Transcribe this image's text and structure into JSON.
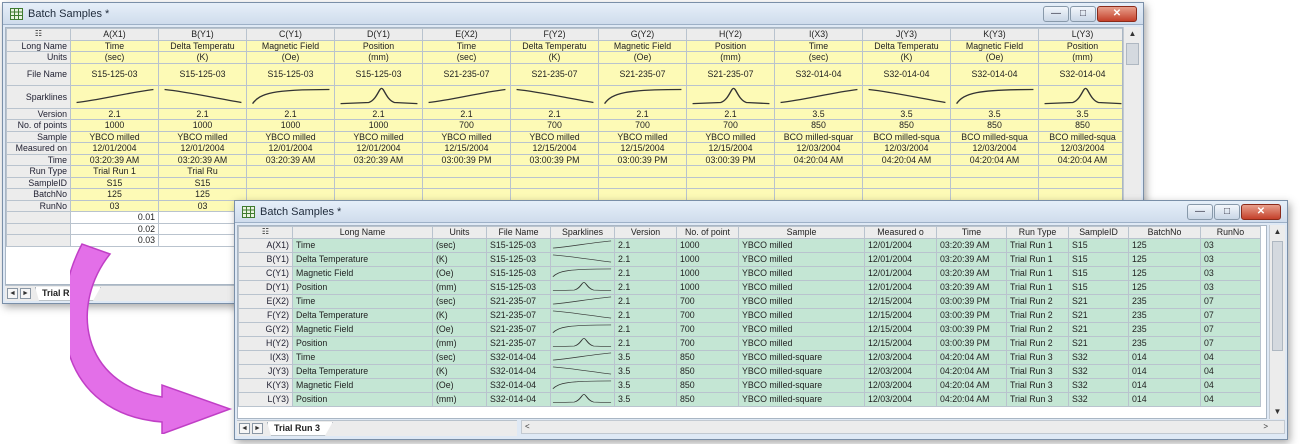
{
  "arrow_color": "#e36fe8",
  "window1": {
    "title": "Batch Samples *",
    "controls": {
      "minimize": "—",
      "maximize": "□",
      "close": "✕"
    },
    "corner_icon": "grid-corner-icon",
    "columns": [
      "A(X1)",
      "B(Y1)",
      "C(Y1)",
      "D(Y1)",
      "E(X2)",
      "F(Y2)",
      "G(Y2)",
      "H(Y2)",
      "I(X3)",
      "J(Y3)",
      "K(Y3)",
      "L(Y3)"
    ],
    "row_headers": {
      "long_name": "Long Name",
      "units": "Units",
      "file_name": "File Name",
      "sparklines": "Sparklines",
      "version": "Version",
      "points": "No. of points",
      "sample": "Sample",
      "measured": "Measured on",
      "time": "Time",
      "run_type": "Run Type",
      "sample_id": "SampleID",
      "batch_no": "BatchNo",
      "run_no": "RunNo"
    },
    "long_name": [
      "Time",
      "Delta Temperatu",
      "Magnetic Field",
      "Position",
      "Time",
      "Delta Temperatu",
      "Magnetic Field",
      "Position",
      "Time",
      "Delta Temperatu",
      "Magnetic Field",
      "Position"
    ],
    "units": [
      "(sec)",
      "(K)",
      "(Oe)",
      "(mm)",
      "(sec)",
      "(K)",
      "(Oe)",
      "(mm)",
      "(sec)",
      "(K)",
      "(Oe)",
      "(mm)"
    ],
    "file_name": [
      "S15-125-03",
      "S15-125-03",
      "S15-125-03",
      "S15-125-03",
      "S21-235-07",
      "S21-235-07",
      "S21-235-07",
      "S21-235-07",
      "S32-014-04",
      "S32-014-04",
      "S32-014-04",
      "S32-014-04"
    ],
    "sparkline_types": [
      "rise",
      "fall",
      "saturate",
      "peak",
      "rise",
      "fall",
      "saturate",
      "peak",
      "rise",
      "fall",
      "saturate",
      "peak"
    ],
    "version": [
      "2.1",
      "2.1",
      "2.1",
      "2.1",
      "2.1",
      "2.1",
      "2.1",
      "2.1",
      "3.5",
      "3.5",
      "3.5",
      "3.5"
    ],
    "points": [
      "1000",
      "1000",
      "1000",
      "1000",
      "700",
      "700",
      "700",
      "700",
      "850",
      "850",
      "850",
      "850"
    ],
    "sample": [
      "YBCO milled",
      "YBCO milled",
      "YBCO milled",
      "YBCO milled",
      "YBCO milled",
      "YBCO milled",
      "YBCO milled",
      "YBCO milled",
      "BCO milled-squar",
      "BCO milled-squa",
      "BCO milled-squa",
      "BCO milled-squa"
    ],
    "measured": [
      "12/01/2004",
      "12/01/2004",
      "12/01/2004",
      "12/01/2004",
      "12/15/2004",
      "12/15/2004",
      "12/15/2004",
      "12/15/2004",
      "12/03/2004",
      "12/03/2004",
      "12/03/2004",
      "12/03/2004"
    ],
    "time": [
      "03:20:39 AM",
      "03:20:39 AM",
      "03:20:39 AM",
      "03:20:39 AM",
      "03:00:39 PM",
      "03:00:39 PM",
      "03:00:39 PM",
      "03:00:39 PM",
      "04:20:04 AM",
      "04:20:04 AM",
      "04:20:04 AM",
      "04:20:04 AM"
    ],
    "run_type": [
      "Trial Run 1",
      "Trial Ru"
    ],
    "sample_id": [
      "S15",
      "S15"
    ],
    "batch_no": [
      "125",
      "125"
    ],
    "run_no": [
      "03",
      "03"
    ],
    "data_values": [
      "0.01",
      "0.02",
      "0.03"
    ],
    "sheet_tab": "Trial Run 1",
    "nav": {
      "prev": "◄",
      "next": "►"
    },
    "scroll_up": "▲"
  },
  "window2": {
    "title": "Batch Samples *",
    "controls": {
      "minimize": "—",
      "maximize": "□",
      "close": "✕"
    },
    "headers": [
      "Long Name",
      "Units",
      "File Name",
      "Sparklines",
      "Version",
      "No. of point",
      "Sample",
      "Measured o",
      "Time",
      "Run Type",
      "SampleID",
      "BatchNo",
      "RunNo"
    ],
    "rows": [
      {
        "label": "A(X1)",
        "long_name": "Time",
        "units": "(sec)",
        "file": "S15-125-03",
        "spark": "rise",
        "version": "2.1",
        "points": "1000",
        "sample": "YBCO milled",
        "measured": "12/01/2004",
        "time": "03:20:39 AM",
        "run_type": "Trial Run 1",
        "sample_id": "S15",
        "batch": "125",
        "run": "03"
      },
      {
        "label": "B(Y1)",
        "long_name": "Delta Temperature",
        "units": "(K)",
        "file": "S15-125-03",
        "spark": "fall",
        "version": "2.1",
        "points": "1000",
        "sample": "YBCO milled",
        "measured": "12/01/2004",
        "time": "03:20:39 AM",
        "run_type": "Trial Run 1",
        "sample_id": "S15",
        "batch": "125",
        "run": "03"
      },
      {
        "label": "C(Y1)",
        "long_name": "Magnetic Field",
        "units": "(Oe)",
        "file": "S15-125-03",
        "spark": "saturate",
        "version": "2.1",
        "points": "1000",
        "sample": "YBCO milled",
        "measured": "12/01/2004",
        "time": "03:20:39 AM",
        "run_type": "Trial Run 1",
        "sample_id": "S15",
        "batch": "125",
        "run": "03"
      },
      {
        "label": "D(Y1)",
        "long_name": "Position",
        "units": "(mm)",
        "file": "S15-125-03",
        "spark": "peak",
        "version": "2.1",
        "points": "1000",
        "sample": "YBCO milled",
        "measured": "12/01/2004",
        "time": "03:20:39 AM",
        "run_type": "Trial Run 1",
        "sample_id": "S15",
        "batch": "125",
        "run": "03"
      },
      {
        "label": "E(X2)",
        "long_name": "Time",
        "units": "(sec)",
        "file": "S21-235-07",
        "spark": "rise",
        "version": "2.1",
        "points": "700",
        "sample": "YBCO milled",
        "measured": "12/15/2004",
        "time": "03:00:39 PM",
        "run_type": "Trial Run 2",
        "sample_id": "S21",
        "batch": "235",
        "run": "07"
      },
      {
        "label": "F(Y2)",
        "long_name": "Delta Temperature",
        "units": "(K)",
        "file": "S21-235-07",
        "spark": "fall",
        "version": "2.1",
        "points": "700",
        "sample": "YBCO milled",
        "measured": "12/15/2004",
        "time": "03:00:39 PM",
        "run_type": "Trial Run 2",
        "sample_id": "S21",
        "batch": "235",
        "run": "07"
      },
      {
        "label": "G(Y2)",
        "long_name": "Magnetic Field",
        "units": "(Oe)",
        "file": "S21-235-07",
        "spark": "saturate",
        "version": "2.1",
        "points": "700",
        "sample": "YBCO milled",
        "measured": "12/15/2004",
        "time": "03:00:39 PM",
        "run_type": "Trial Run 2",
        "sample_id": "S21",
        "batch": "235",
        "run": "07"
      },
      {
        "label": "H(Y2)",
        "long_name": "Position",
        "units": "(mm)",
        "file": "S21-235-07",
        "spark": "peak",
        "version": "2.1",
        "points": "700",
        "sample": "YBCO milled",
        "measured": "12/15/2004",
        "time": "03:00:39 PM",
        "run_type": "Trial Run 2",
        "sample_id": "S21",
        "batch": "235",
        "run": "07"
      },
      {
        "label": "I(X3)",
        "long_name": "Time",
        "units": "(sec)",
        "file": "S32-014-04",
        "spark": "rise",
        "version": "3.5",
        "points": "850",
        "sample": "YBCO milled-square",
        "measured": "12/03/2004",
        "time": "04:20:04 AM",
        "run_type": "Trial Run 3",
        "sample_id": "S32",
        "batch": "014",
        "run": "04"
      },
      {
        "label": "J(Y3)",
        "long_name": "Delta Temperature",
        "units": "(K)",
        "file": "S32-014-04",
        "spark": "fall",
        "version": "3.5",
        "points": "850",
        "sample": "YBCO milled-square",
        "measured": "12/03/2004",
        "time": "04:20:04 AM",
        "run_type": "Trial Run 3",
        "sample_id": "S32",
        "batch": "014",
        "run": "04"
      },
      {
        "label": "K(Y3)",
        "long_name": "Magnetic Field",
        "units": "(Oe)",
        "file": "S32-014-04",
        "spark": "saturate",
        "version": "3.5",
        "points": "850",
        "sample": "YBCO milled-square",
        "measured": "12/03/2004",
        "time": "04:20:04 AM",
        "run_type": "Trial Run 3",
        "sample_id": "S32",
        "batch": "014",
        "run": "04"
      },
      {
        "label": "L(Y3)",
        "long_name": "Position",
        "units": "(mm)",
        "file": "S32-014-04",
        "spark": "peak",
        "version": "3.5",
        "points": "850",
        "sample": "YBCO milled-square",
        "measured": "12/03/2004",
        "time": "04:20:04 AM",
        "run_type": "Trial Run 3",
        "sample_id": "S32",
        "batch": "014",
        "run": "04"
      }
    ],
    "sheet_tab": "Trial Run 3",
    "nav": {
      "prev": "◄",
      "next": "►"
    },
    "scroll_up": "▲",
    "scroll_down": "▼",
    "hscroll_left": "<",
    "hscroll_right": ">"
  }
}
